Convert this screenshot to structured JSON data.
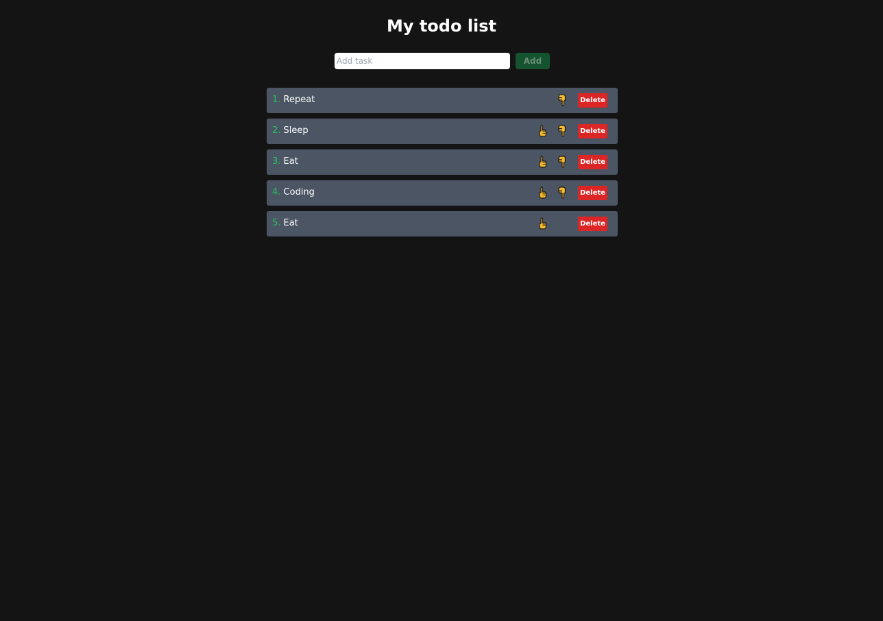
{
  "header": {
    "title": "My todo list"
  },
  "add_form": {
    "placeholder": "Add task",
    "button_label": "Add"
  },
  "tasks": [
    {
      "number": "1.",
      "text": "Repeat",
      "show_up": false,
      "show_down": true,
      "up_icon": "pointing-up-icon",
      "down_icon": "pointing-down-icon",
      "delete_label": "Delete"
    },
    {
      "number": "2.",
      "text": "Sleep",
      "show_up": true,
      "show_down": true,
      "up_icon": "pointing-up-icon",
      "down_icon": "pointing-down-icon",
      "delete_label": "Delete"
    },
    {
      "number": "3.",
      "text": "Eat",
      "show_up": true,
      "show_down": true,
      "up_icon": "pointing-up-icon",
      "down_icon": "pointing-down-icon",
      "delete_label": "Delete"
    },
    {
      "number": "4.",
      "text": "Coding",
      "show_up": true,
      "show_down": true,
      "up_icon": "pointing-up-icon",
      "down_icon": "pointing-down-icon",
      "delete_label": "Delete"
    },
    {
      "number": "5.",
      "text": "Eat",
      "show_up": true,
      "show_down": false,
      "up_icon": "pointing-up-icon",
      "down_icon": "pointing-down-icon",
      "delete_label": "Delete"
    }
  ],
  "colors": {
    "background": "#141414",
    "item_background": "#4b5563",
    "number": "#22c55e",
    "delete": "#dc2626",
    "add_button": "#14532d",
    "hand": "#f6b92b"
  }
}
